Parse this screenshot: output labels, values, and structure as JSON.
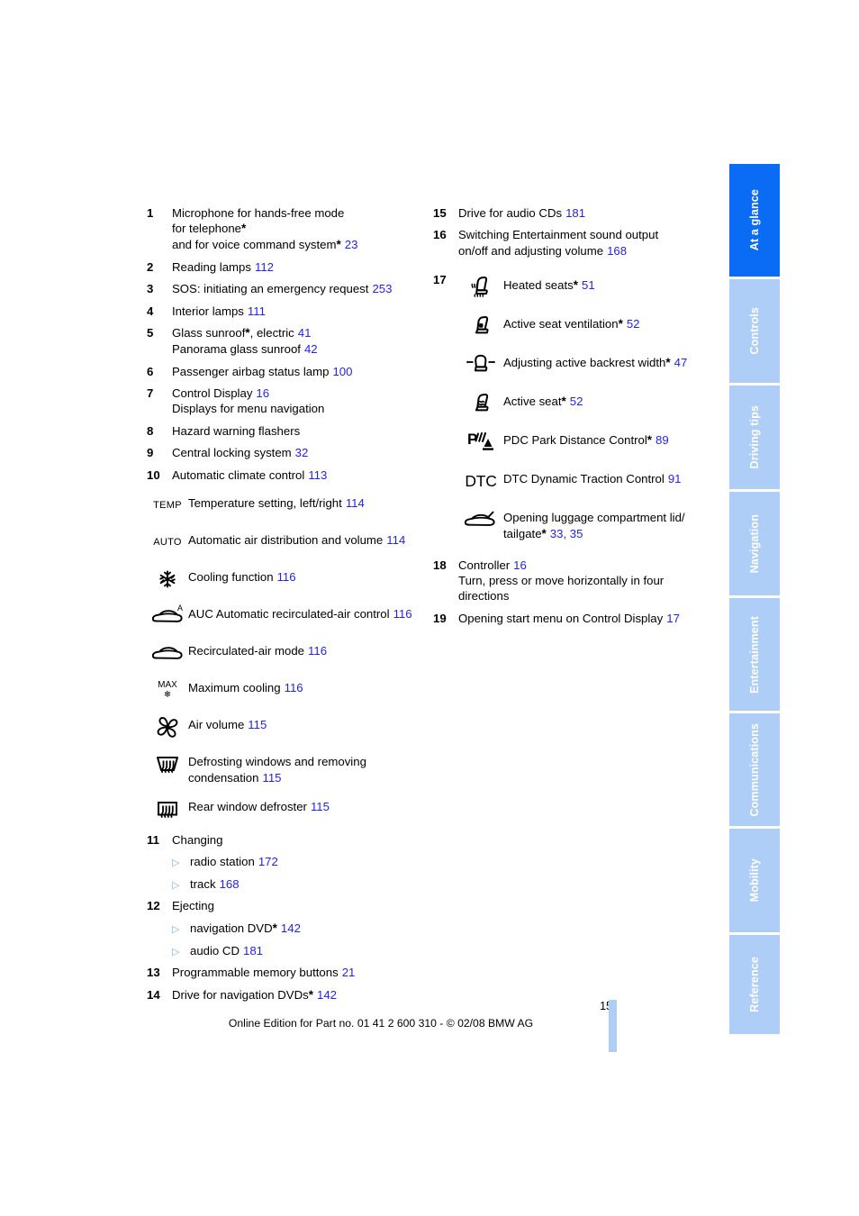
{
  "page": {
    "number": "15",
    "footer_text": "Online Edition for Part no. 01 41 2 600 310 - © 02/08 BMW AG",
    "ref_color": "#2222ee",
    "active_tab_color": "#0a6cf5",
    "idle_tab_color": "#aecdf7"
  },
  "tabs": [
    {
      "label": "At a glance",
      "active": true
    },
    {
      "label": "Controls",
      "active": false
    },
    {
      "label": "Driving tips",
      "active": false
    },
    {
      "label": "Navigation",
      "active": false
    },
    {
      "label": "Entertainment",
      "active": false
    },
    {
      "label": "Communications",
      "active": false
    },
    {
      "label": "Mobility",
      "active": false
    },
    {
      "label": "Reference",
      "active": false
    }
  ],
  "left_column": {
    "item1": {
      "num": "1",
      "line1": "Microphone for hands-free mode",
      "line2": "for telephone",
      "line3": "and for voice command system",
      "ref": "23"
    },
    "item2": {
      "num": "2",
      "text": "Reading lamps",
      "ref": "112"
    },
    "item3": {
      "num": "3",
      "text": "SOS: initiating an emergency request",
      "ref": "253"
    },
    "item4": {
      "num": "4",
      "text": "Interior lamps",
      "ref": "111"
    },
    "item5": {
      "num": "5",
      "line1a": "Glass sunroof",
      "line1b": ", electric",
      "ref1": "41",
      "line2": "Panorama glass sunroof",
      "ref2": "42"
    },
    "item6": {
      "num": "6",
      "text": "Passenger airbag status lamp",
      "ref": "100"
    },
    "item7": {
      "num": "7",
      "line1": "Control Display",
      "ref": "16",
      "line2": "Displays for menu navigation"
    },
    "item8": {
      "num": "8",
      "text": "Hazard warning flashers"
    },
    "item9": {
      "num": "9",
      "text": "Central locking system",
      "ref": "32"
    },
    "item10": {
      "num": "10",
      "text": "Automatic climate control",
      "ref": "113"
    },
    "climate_icons": [
      {
        "icon": "temp-label-icon",
        "glyph": "TEMP",
        "line1": "Temperature setting,",
        "line2": "left/right",
        "ref": "114"
      },
      {
        "icon": "auto-label-icon",
        "glyph": "AUTO",
        "line1": "Automatic air distribution and",
        "line2": "volume",
        "ref": "114"
      },
      {
        "icon": "snowflake-icon",
        "line1": "Cooling function",
        "ref": "116"
      },
      {
        "icon": "auc-recirculated-air-icon",
        "line1": "AUC Automatic recirculated-air",
        "line2": "control",
        "ref": "116"
      },
      {
        "icon": "recirculated-air-icon",
        "line1": "Recirculated-air mode",
        "ref": "116"
      },
      {
        "icon": "max-cooling-icon",
        "glyph": "MAX",
        "line1": "Maximum cooling",
        "ref": "116"
      },
      {
        "icon": "fan-icon",
        "line1": "Air volume",
        "ref": "115"
      },
      {
        "icon": "windshield-defrost-icon",
        "line1": "Defrosting windows and removing",
        "line2": "condensation",
        "ref": "115"
      },
      {
        "icon": "rear-defroster-icon",
        "line1": "Rear window defroster",
        "ref": "115"
      }
    ],
    "item11": {
      "num": "11",
      "text": "Changing",
      "subs": [
        {
          "text": "radio station",
          "ref": "172"
        },
        {
          "text": "track",
          "ref": "168"
        }
      ]
    },
    "item12": {
      "num": "12",
      "text": "Ejecting",
      "subs": [
        {
          "text": "navigation DVD",
          "asterisk": true,
          "ref": "142"
        },
        {
          "text": "audio CD",
          "asterisk": false,
          "ref": "181"
        }
      ]
    },
    "item13": {
      "num": "13",
      "text": "Programmable memory buttons",
      "ref": "21"
    },
    "item14": {
      "num": "14",
      "text": "Drive for navigation DVDs",
      "ref": "142"
    }
  },
  "right_column": {
    "item15": {
      "num": "15",
      "text": "Drive for audio CDs",
      "ref": "181"
    },
    "item16": {
      "num": "16",
      "line1": "Switching Entertainment sound output",
      "line2": "on/off and adjusting volume",
      "ref": "168"
    },
    "item17": {
      "num": "17",
      "icons": [
        {
          "icon": "heated-seat-icon",
          "line1": "Heated seats",
          "asterisk": true,
          "ref": "51"
        },
        {
          "icon": "seat-ventilation-icon",
          "line1": "Active seat ventilation",
          "asterisk": true,
          "ref": "52"
        },
        {
          "icon": "backrest-width-icon",
          "line1": "Adjusting active backrest",
          "line2": "width",
          "asterisk": true,
          "ref": "47"
        },
        {
          "icon": "active-seat-icon",
          "line1": "Active seat",
          "asterisk": true,
          "ref": "52"
        },
        {
          "icon": "pdc-icon",
          "line1": "PDC Park Distance Control",
          "asterisk": true,
          "ref": "89"
        },
        {
          "icon": "dtc-label-icon",
          "glyph": "DTC",
          "line1": "DTC Dynamic Traction Control",
          "asterisk": false,
          "ref": "91"
        },
        {
          "icon": "trunk-lid-icon",
          "line1": "Opening luggage compartment lid/",
          "line2": "tailgate",
          "asterisk": true,
          "ref": "33, 35"
        }
      ]
    },
    "item18": {
      "num": "18",
      "line1": "Controller",
      "ref": "16",
      "line2": "Turn, press or move horizontally in four",
      "line3": "directions"
    },
    "item19": {
      "num": "19",
      "text": "Opening start menu on Control Display",
      "ref": "17"
    }
  }
}
